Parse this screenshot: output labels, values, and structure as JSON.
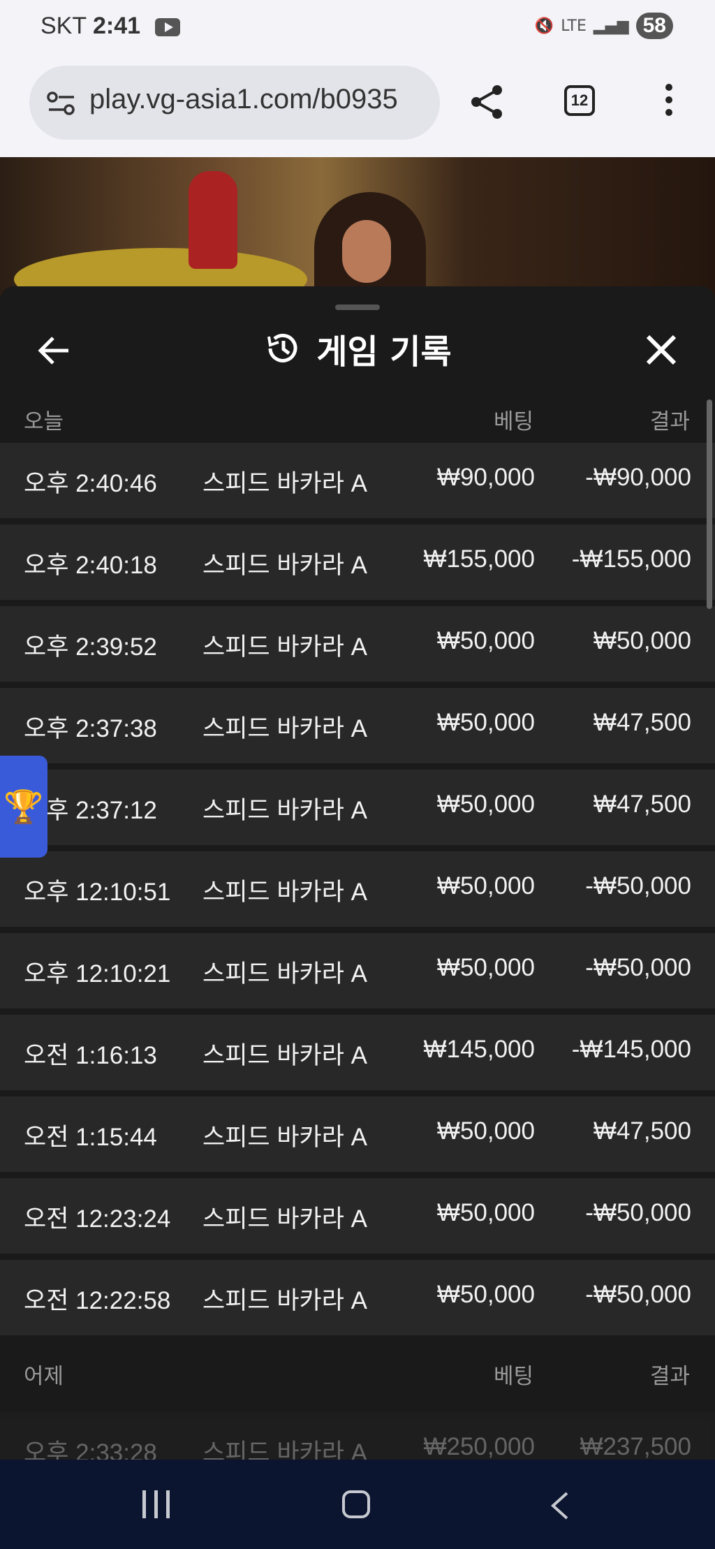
{
  "status_bar": {
    "carrier": "SKT",
    "time": "2:41",
    "battery": "58",
    "network": "LTE"
  },
  "browser": {
    "url": "play.vg-asia1.com/b0935",
    "tab_count": "12"
  },
  "panel": {
    "title": "게임 기록",
    "sections": [
      {
        "day": "오늘",
        "bet_header": "베팅",
        "result_header": "결과",
        "rows": [
          {
            "time": "오후 2:40:46",
            "game": "스피드 바카라 A",
            "bet": "₩90,000",
            "result": "-₩90,000"
          },
          {
            "time": "오후 2:40:18",
            "game": "스피드 바카라 A",
            "bet": "₩155,000",
            "result": "-₩155,000"
          },
          {
            "time": "오후 2:39:52",
            "game": "스피드 바카라 A",
            "bet": "₩50,000",
            "result": "₩50,000"
          },
          {
            "time": "오후 2:37:38",
            "game": "스피드 바카라 A",
            "bet": "₩50,000",
            "result": "₩47,500"
          },
          {
            "time": "오후 2:37:12",
            "game": "스피드 바카라 A",
            "bet": "₩50,000",
            "result": "₩47,500"
          },
          {
            "time": "오후 12:10:51",
            "game": "스피드 바카라 A",
            "bet": "₩50,000",
            "result": "-₩50,000"
          },
          {
            "time": "오후 12:10:21",
            "game": "스피드 바카라 A",
            "bet": "₩50,000",
            "result": "-₩50,000"
          },
          {
            "time": "오전 1:16:13",
            "game": "스피드 바카라 A",
            "bet": "₩145,000",
            "result": "-₩145,000"
          },
          {
            "time": "오전 1:15:44",
            "game": "스피드 바카라 A",
            "bet": "₩50,000",
            "result": "₩47,500"
          },
          {
            "time": "오전 12:23:24",
            "game": "스피드 바카라 A",
            "bet": "₩50,000",
            "result": "-₩50,000"
          },
          {
            "time": "오전 12:22:58",
            "game": "스피드 바카라 A",
            "bet": "₩50,000",
            "result": "-₩50,000"
          }
        ]
      },
      {
        "day": "어제",
        "bet_header": "베팅",
        "result_header": "결과",
        "rows": [
          {
            "time": "오후 2:33:28",
            "game": "스피드 바카라 A",
            "bet": "₩250,000",
            "result": "₩237,500"
          }
        ]
      }
    ]
  },
  "icons": {
    "back": "arrow-left-icon",
    "history": "history-icon",
    "close": "close-icon",
    "share": "share-icon",
    "menu": "more-vert-icon",
    "trophy": "trophy-icon"
  }
}
